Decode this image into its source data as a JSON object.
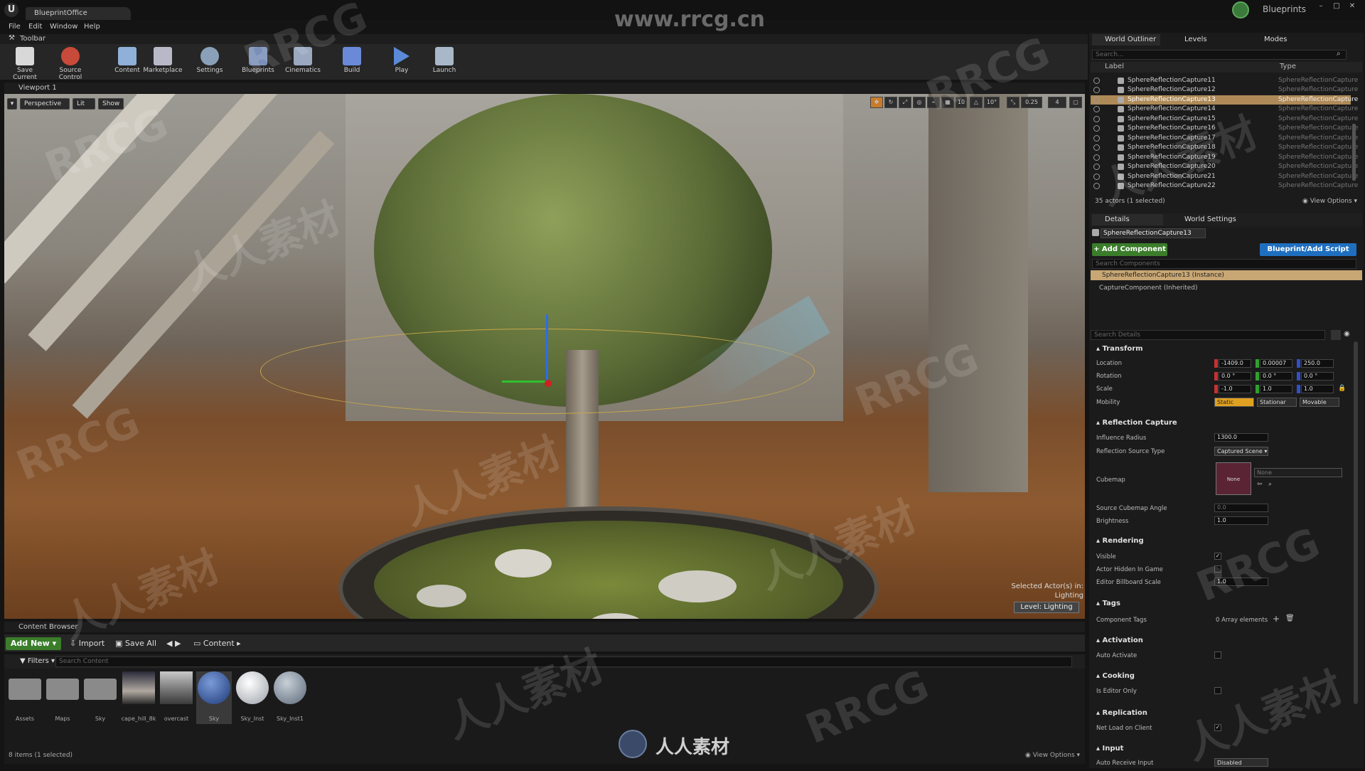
{
  "app": {
    "project_tab": "BlueprintOffice",
    "watermark_url": "www.rrcg.cn",
    "blueprints_label": "Blueprints"
  },
  "menu": [
    "File",
    "Edit",
    "Window",
    "Help"
  ],
  "toolbar": {
    "title": "Toolbar",
    "buttons": [
      "Save Current",
      "Source Control",
      "Content",
      "Marketplace",
      "Settings",
      "Blueprints",
      "Cinematics",
      "Build",
      "Play",
      "Launch"
    ]
  },
  "viewport": {
    "tab": "Viewport 1",
    "perspective": "Perspective",
    "lit": "Lit",
    "show": "Show",
    "grid_snap": "10",
    "rot_snap": "10°",
    "scale_snap": "0.25",
    "cam_speed": "4",
    "selected_info": "Selected Actor(s) in:",
    "selected_level": "Lighting",
    "level_badge": "Level:  Lighting"
  },
  "content_browser": {
    "tab": "Content Browser",
    "add_new": "Add New",
    "import": "Import",
    "save_all": "Save All",
    "path": "Content",
    "filters": "Filters",
    "search_placeholder": "Search Content",
    "assets": [
      "Assets",
      "Maps",
      "Sky",
      "cape_hill_8k",
      "overcast",
      "Sky",
      "Sky_Inst",
      "Sky_Inst1"
    ],
    "count": "8 items (1 selected)",
    "view_options": "View Options"
  },
  "outliner": {
    "tabs": [
      "World Outliner",
      "Levels",
      "Modes"
    ],
    "search_placeholder": "Search...",
    "col_label": "Label",
    "col_type": "Type",
    "rows": [
      {
        "label": "SphereReflectionCapture11",
        "type": "SphereReflectionCapture"
      },
      {
        "label": "SphereReflectionCapture12",
        "type": "SphereReflectionCapture"
      },
      {
        "label": "SphereReflectionCapture13",
        "type": "SphereReflectionCapture"
      },
      {
        "label": "SphereReflectionCapture14",
        "type": "SphereReflectionCapture"
      },
      {
        "label": "SphereReflectionCapture15",
        "type": "SphereReflectionCapture"
      },
      {
        "label": "SphereReflectionCapture16",
        "type": "SphereReflectionCapture"
      },
      {
        "label": "SphereReflectionCapture17",
        "type": "SphereReflectionCapture"
      },
      {
        "label": "SphereReflectionCapture18",
        "type": "SphereReflectionCapture"
      },
      {
        "label": "SphereReflectionCapture19",
        "type": "SphereReflectionCapture"
      },
      {
        "label": "SphereReflectionCapture20",
        "type": "SphereReflectionCapture"
      },
      {
        "label": "SphereReflectionCapture21",
        "type": "SphereReflectionCapture"
      },
      {
        "label": "SphereReflectionCapture22",
        "type": "SphereReflectionCapture"
      }
    ],
    "status": "35 actors (1 selected)",
    "view_options": "View Options"
  },
  "details": {
    "tabs": [
      "Details",
      "World Settings"
    ],
    "name": "SphereReflectionCapture13",
    "add_component": "+ Add Component",
    "blueprint_script": "Blueprint/Add Script",
    "search_components": "Search Components",
    "instance": "SphereReflectionCapture13 (Instance)",
    "capture_component": "CaptureComponent (Inherited)",
    "search_details": "Search Details",
    "transform": {
      "title": "Transform",
      "location_label": "Location",
      "location": [
        "-1409.0",
        "0.00007",
        "250.0"
      ],
      "rotation_label": "Rotation",
      "rotation": [
        "0.0 °",
        "0.0 °",
        "0.0 °"
      ],
      "scale_label": "Scale",
      "scale": [
        "-1.0",
        "1.0",
        "1.0"
      ],
      "mobility_label": "Mobility",
      "mobility": [
        "Static",
        "Stationar",
        "Movable"
      ]
    },
    "reflection": {
      "title": "Reflection Capture",
      "influence_label": "Influence Radius",
      "influence": "1300.0",
      "source_type_label": "Reflection Source Type",
      "source_type": "Captured Scene",
      "cubemap_label": "Cubemap",
      "cubemap": "None",
      "cubemap_select": "None",
      "angle_label": "Source Cubemap Angle",
      "angle": "0.0",
      "brightness_label": "Brightness",
      "brightness": "1.0"
    },
    "rendering": {
      "title": "Rendering",
      "visible_label": "Visible",
      "hidden_label": "Actor Hidden In Game",
      "billboard_label": "Editor Billboard Scale",
      "billboard": "1.0"
    },
    "tags": {
      "title": "Tags",
      "component_tags_label": "Component Tags",
      "value": "0 Array elements"
    },
    "activation": {
      "title": "Activation",
      "auto_activate_label": "Auto Activate"
    },
    "cooking": {
      "title": "Cooking",
      "editor_only_label": "Is Editor Only"
    },
    "replication": {
      "title": "Replication",
      "net_load_label": "Net Load on Client"
    },
    "input": {
      "title": "Input",
      "auto_receive_label": "Auto Receive Input",
      "auto_receive": "Disabled"
    }
  },
  "watermarks": [
    "RRCG",
    "人人素材"
  ],
  "logo_text": "人人素材",
  "colors": {
    "accent_green": "#3b7d2b",
    "accent_blue": "#1f6fc0",
    "selection": "#ae8a58"
  }
}
